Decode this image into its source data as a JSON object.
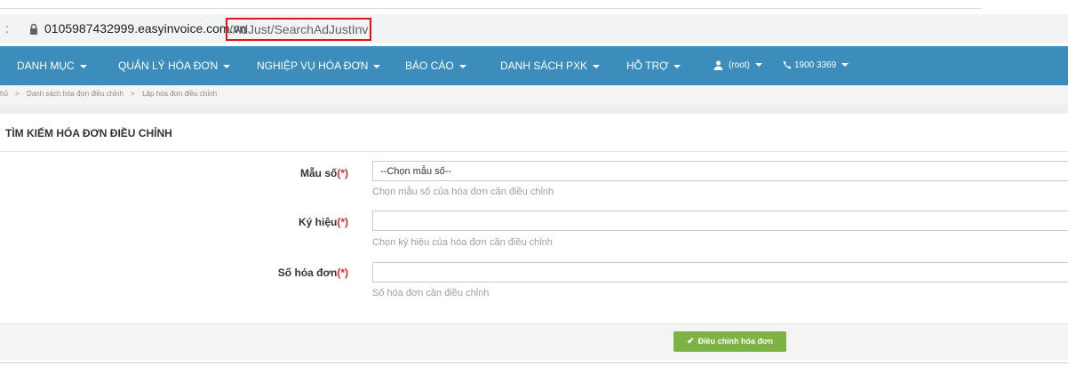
{
  "browser": {
    "nav_fragment": ":",
    "url_domain": "0105987432999.easyinvoice.com.vn",
    "url_path": "/AdJust/SearchAdJustInv"
  },
  "navbar": {
    "items": [
      {
        "label": "DANH MỤC"
      },
      {
        "label": "QUẢN LÝ HÓA ĐƠN"
      },
      {
        "label": "NGHIỆP VỤ HÓA ĐƠN"
      },
      {
        "label": "BÁO CÁO"
      },
      {
        "label": "DANH SÁCH PXK"
      },
      {
        "label": "HỖ TRỢ"
      }
    ],
    "user": "(root)",
    "phone": "1900 3369"
  },
  "breadcrumb": {
    "home": "hủ",
    "sep": ">",
    "list": "Danh sách hóa đơn điều chỉnh",
    "current": "Lập hóa đơn điều chỉnh"
  },
  "panel": {
    "title": "TÌM KIẾM HÓA ĐƠN ĐIỀU CHỈNH",
    "required_mark": "(*)",
    "fields": {
      "mau_so": {
        "label": "Mẫu số",
        "value": "--Chọn mẫu số--",
        "help": "Chọn mẫu số của hóa đơn cần điều chỉnh"
      },
      "ky_hieu": {
        "label": "Ký hiệu",
        "value": "",
        "help": "Chọn ký hiệu của hóa đơn cần điều chỉnh"
      },
      "so_hoa_don": {
        "label": "Số hóa đơn",
        "value": "",
        "help": "Số hóa đơn cần điều chỉnh"
      }
    },
    "submit_label": "Điều chỉnh hóa đơn"
  }
}
